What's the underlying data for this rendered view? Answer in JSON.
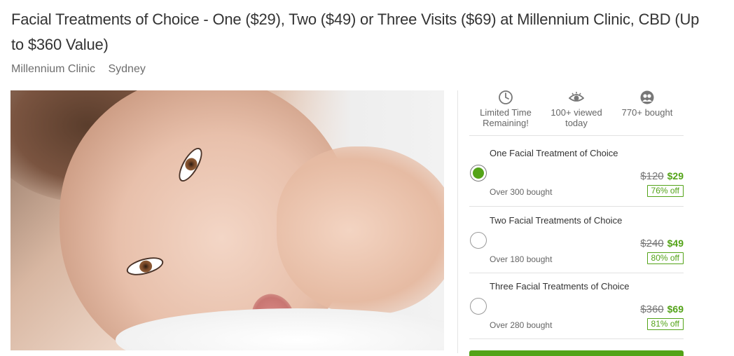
{
  "deal": {
    "title": "Facial Treatments of Choice - One ($29), Two ($49) or Three Visits ($69) at Millennium Clinic, CBD (Up to $360 Value)",
    "merchant": "Millennium Clinic",
    "location": "Sydney"
  },
  "stats": [
    {
      "icon": "clock-icon",
      "text": "Limited Time Remaining!"
    },
    {
      "icon": "eye-icon",
      "text": "100+ viewed today"
    },
    {
      "icon": "people-icon",
      "text": "770+ bought"
    }
  ],
  "options": [
    {
      "name": "One Facial Treatment of Choice",
      "original_price": "$120",
      "price": "$29",
      "discount": "76% off",
      "bought": "Over 300 bought",
      "selected": true
    },
    {
      "name": "Two Facial Treatments of Choice",
      "original_price": "$240",
      "price": "$49",
      "discount": "80% off",
      "bought": "Over 180 bought",
      "selected": false
    },
    {
      "name": "Three Facial Treatments of Choice",
      "original_price": "$360",
      "price": "$69",
      "discount": "81% off",
      "bought": "Over 280 bought",
      "selected": false
    }
  ],
  "colors": {
    "accent": "#53a318",
    "text": "#333333",
    "muted": "#6e6e6e"
  }
}
